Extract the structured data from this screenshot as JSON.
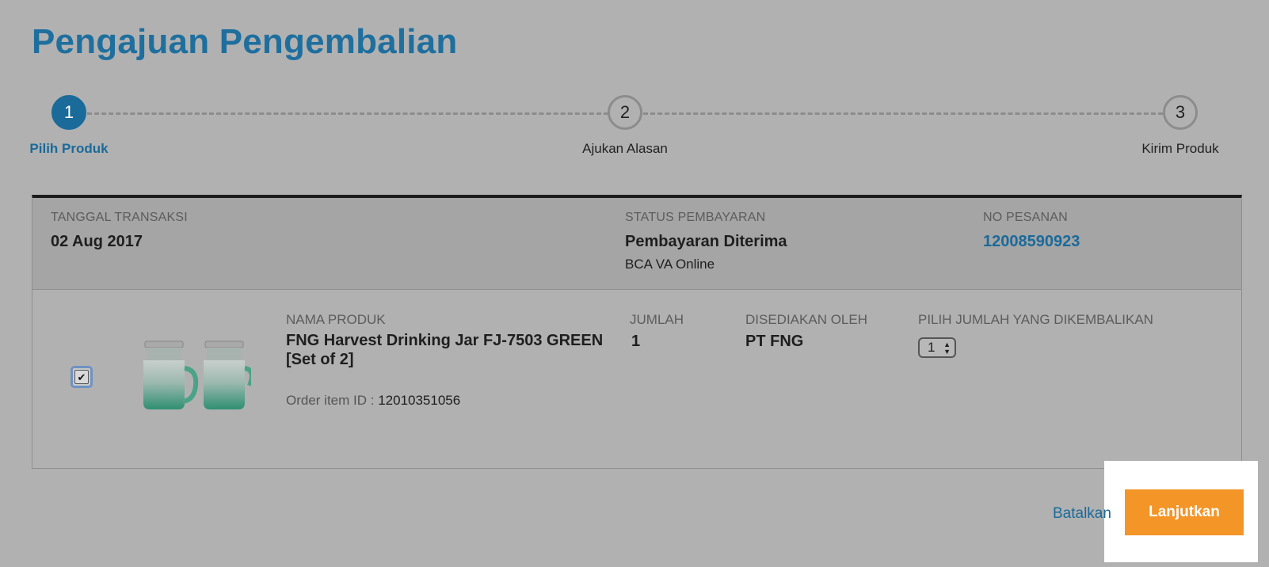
{
  "page": {
    "title": "Pengajuan Pengembalian"
  },
  "steps": [
    {
      "number": "1",
      "label": "Pilih Produk"
    },
    {
      "number": "2",
      "label": "Ajukan Alasan"
    },
    {
      "number": "3",
      "label": "Kirim Produk"
    }
  ],
  "order": {
    "transaction_date_label": "TANGGAL TRANSAKSI",
    "transaction_date": "02 Aug 2017",
    "payment_status_label": "STATUS PEMBAYARAN",
    "payment_status": "Pembayaran Diterima",
    "payment_method": "BCA VA Online",
    "order_number_label": "NO PESANAN",
    "order_number": "12008590923"
  },
  "product": {
    "name_label": "NAMA PRODUK",
    "name": "FNG Harvest Drinking Jar FJ-7503 GREEN [Set of 2]",
    "order_item_label": "Order item ID :",
    "order_item_id": "12010351056",
    "qty_label": "JUMLAH",
    "qty": "1",
    "provider_label": "DISEDIAKAN OLEH",
    "provider": "PT FNG",
    "return_qty_label": "PILIH JUMLAH YANG DIKEMBALIKAN",
    "return_qty": "1",
    "checked_glyph": "✔"
  },
  "actions": {
    "cancel_label": "Batalkan",
    "continue_label": "Lanjutkan"
  },
  "colors": {
    "accent_blue": "#1a6a9a",
    "button_orange": "#f39527",
    "overlay_gray": "#b1b1b1"
  },
  "icons": {
    "check": "check-icon",
    "select_arrows": "sort-arrows-icon"
  }
}
